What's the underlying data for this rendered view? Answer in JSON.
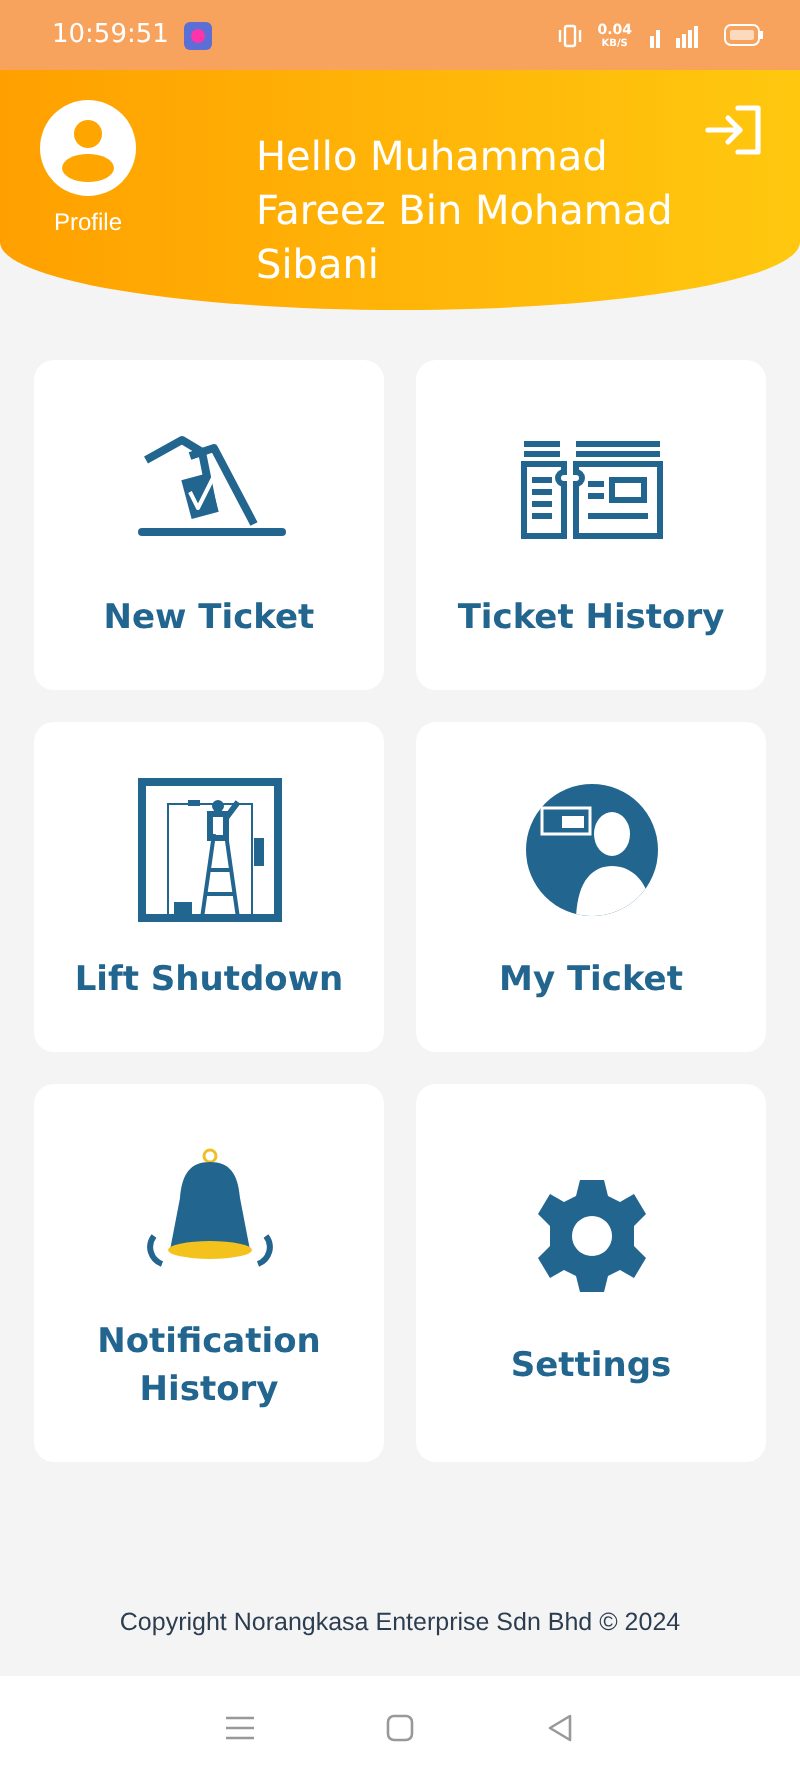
{
  "status_bar": {
    "time": "10:59:51",
    "net_speed": "0.04",
    "net_unit": "KB/S"
  },
  "header": {
    "profile_label": "Profile",
    "greeting": "Hello Muhammad Fareez Bin Mohamad Sibani"
  },
  "menu": [
    {
      "label": "New Ticket",
      "kind": "ballot"
    },
    {
      "label": "Ticket History",
      "kind": "tickets"
    },
    {
      "label": "Lift Shutdown",
      "kind": "lift"
    },
    {
      "label": "My Ticket",
      "kind": "user"
    },
    {
      "label": "Notification History",
      "kind": "bell"
    },
    {
      "label": "Settings",
      "kind": "gear"
    }
  ],
  "footer": {
    "copyright": "Copyright Norangkasa Enterprise Sdn Bhd © 2024"
  }
}
